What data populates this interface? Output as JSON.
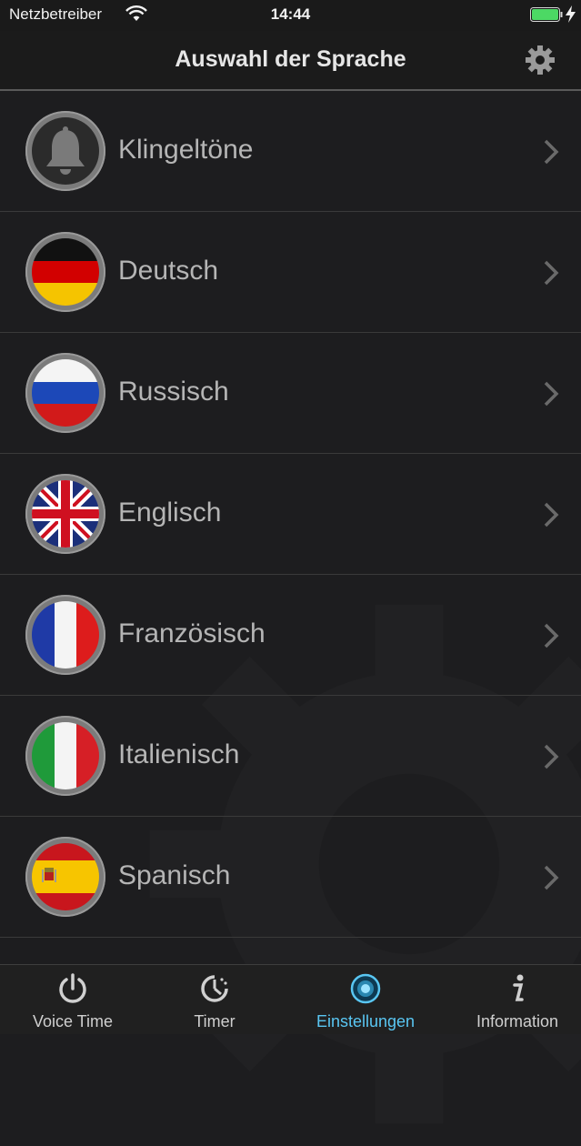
{
  "status_bar": {
    "carrier": "Netzbetreiber",
    "time": "14:44",
    "battery_color": "#4cd964"
  },
  "nav": {
    "title": "Auswahl der Sprache"
  },
  "rows": [
    {
      "label": "Klingeltöne",
      "icon": "bell-icon"
    },
    {
      "label": "Deutsch",
      "icon": "german-flag-icon"
    },
    {
      "label": "Russisch",
      "icon": "russian-flag-icon"
    },
    {
      "label": "Englisch",
      "icon": "uk-flag-icon"
    },
    {
      "label": "Französisch",
      "icon": "french-flag-icon"
    },
    {
      "label": "Italienisch",
      "icon": "italian-flag-icon"
    },
    {
      "label": "Spanisch",
      "icon": "spanish-flag-icon"
    }
  ],
  "tabs": [
    {
      "label": "Voice Time",
      "icon": "power-icon"
    },
    {
      "label": "Timer",
      "icon": "timer-icon"
    },
    {
      "label": "Einstellungen",
      "icon": "settings-dial-icon",
      "active": true
    },
    {
      "label": "Information",
      "icon": "info-icon"
    }
  ],
  "colors": {
    "accent": "#59c6f2",
    "background": "#1d1d1f"
  }
}
